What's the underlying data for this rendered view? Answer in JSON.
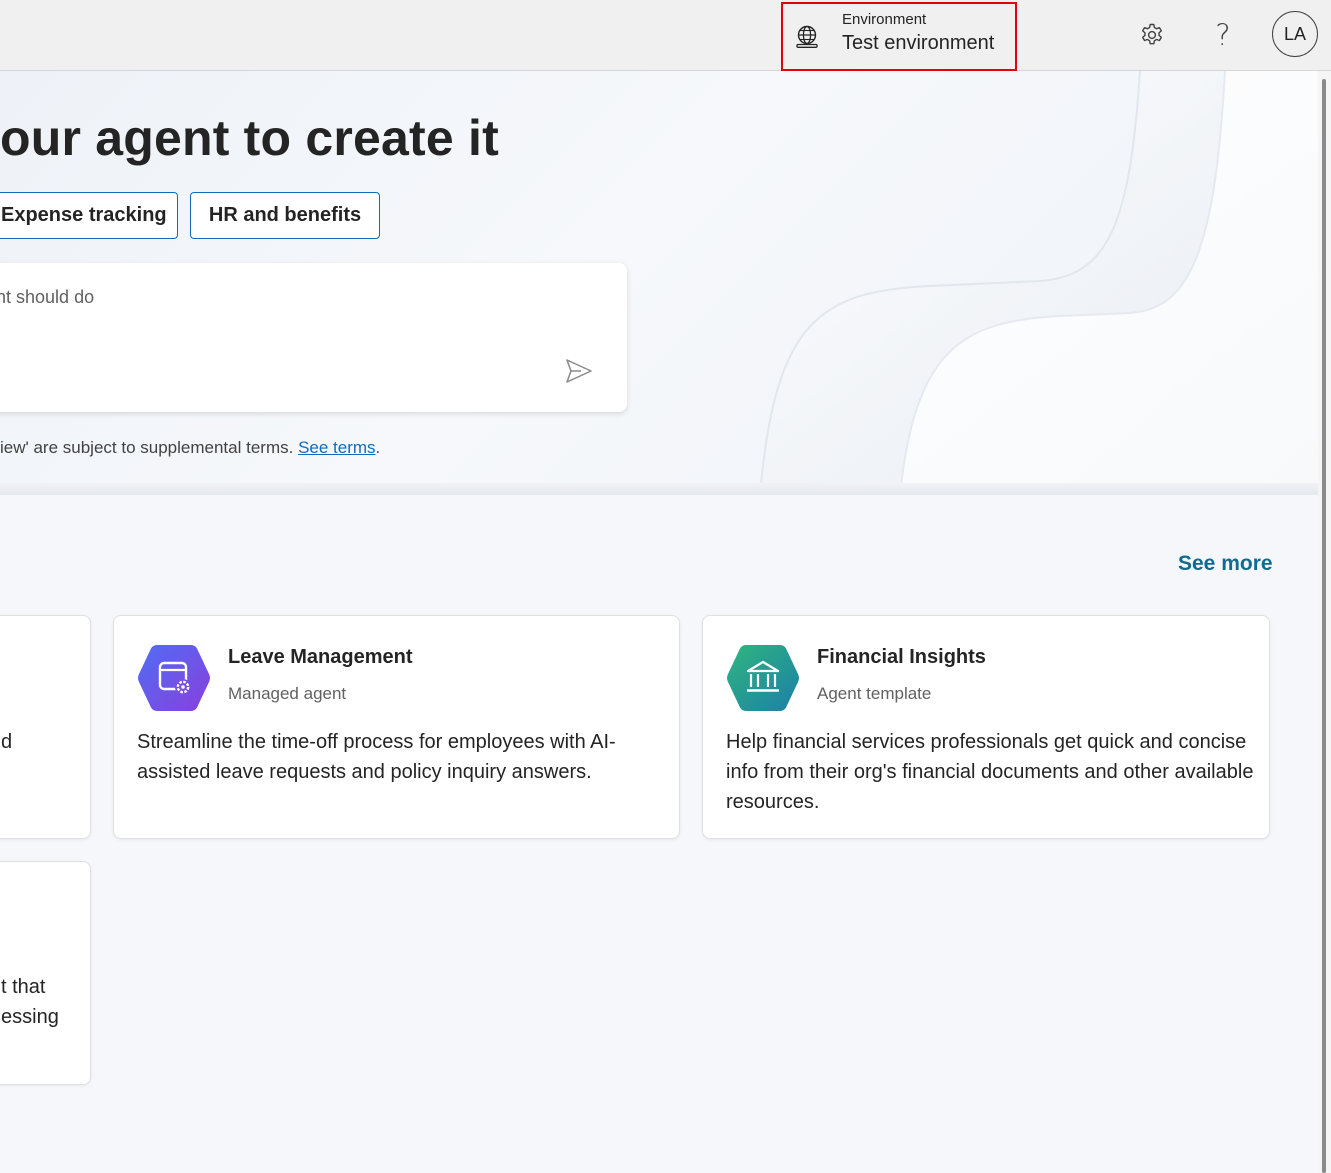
{
  "header": {
    "environment_label": "Environment",
    "environment_value": "Test environment",
    "settings_icon": "gear-icon",
    "help_icon": "question-icon",
    "help_glyph": "?",
    "avatar_initials": "LA"
  },
  "hero": {
    "title": "our agent to create it",
    "chips": [
      "Expense tracking",
      "HR and benefits"
    ],
    "prompt_placeholder": "ent should do",
    "terms_text": "iew' are subject to supplemental terms.",
    "terms_link": "See terms",
    "terms_end": "."
  },
  "agents": {
    "see_more": "See more",
    "cards": [
      {
        "title": "Leave Management",
        "subtitle": "Managed agent",
        "description": "Streamline the time-off process for employees with AI-assisted leave requests and policy inquiry answers.",
        "icon": "calendar-gear-icon",
        "color": "#6b4fe0"
      },
      {
        "title": "Financial Insights",
        "subtitle": "Agent template",
        "description": "Help financial services professionals get quick and concise info from their org's financial documents and other available resources.",
        "icon": "bank-icon",
        "color": "#1f9e84"
      }
    ],
    "left_fragments": {
      "card1_line": "d",
      "card2_line1": "t that",
      "card2_line2": "essing"
    }
  },
  "colors": {
    "accent": "#0f6cbd",
    "highlight": "#e3000f",
    "see_more": "#0f6c8e"
  }
}
